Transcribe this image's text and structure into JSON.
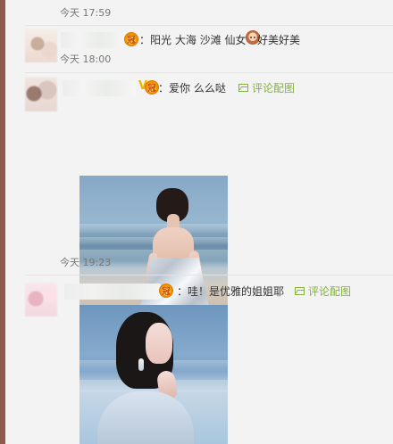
{
  "comments": [
    {
      "time": "今天 17:59"
    },
    {
      "text": "：阳光 大海 沙滩 仙女",
      "text_after": " 好美好美",
      "time": "今天 18:00"
    },
    {
      "text": "：爱你 么么哒",
      "link": "评论配图",
      "time": "今天 19:23"
    },
    {
      "text": "：哇！是优雅的姐姐耶",
      "link": "评论配图"
    }
  ],
  "icons": {
    "vip_badge": "crown-badge",
    "verified_badge": "verified-v",
    "image_link": "image-icon",
    "emoji": "face-emoji"
  },
  "colors": {
    "accent_link": "#84b23b",
    "left_rail": "#8d5a4c",
    "panel_bg": "#f3f3f4"
  }
}
